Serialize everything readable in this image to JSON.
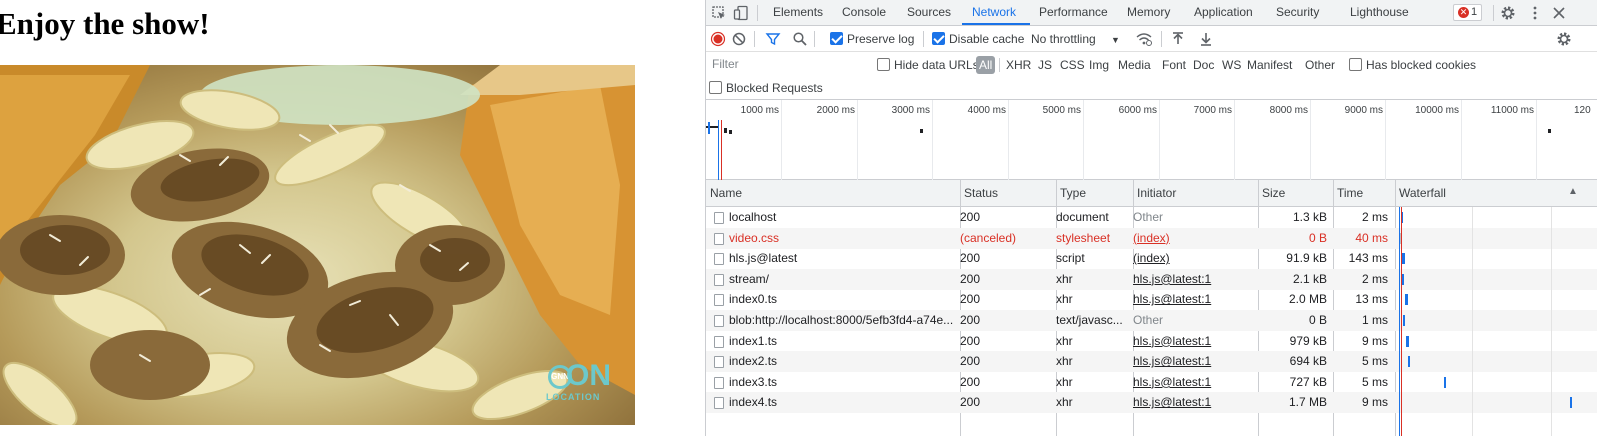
{
  "page": {
    "heading": "Enjoy the show!",
    "video_logo_big": "ON",
    "video_logo_small": "LOCATION",
    "video_logo_ring": "GNN"
  },
  "devtools": {
    "tabs": [
      "Elements",
      "Console",
      "Sources",
      "Network",
      "Performance",
      "Memory",
      "Application",
      "Security",
      "Lighthouse"
    ],
    "active_tab": "Network",
    "error_count": "1",
    "toolbar": {
      "preserve_log": "Preserve log",
      "preserve_log_checked": true,
      "disable_cache": "Disable cache",
      "disable_cache_checked": true,
      "throttling": "No throttling"
    },
    "filter": {
      "placeholder": "Filter",
      "hide_data_urls": "Hide data URLs",
      "types": [
        "All",
        "XHR",
        "JS",
        "CSS",
        "Img",
        "Media",
        "Font",
        "Doc",
        "WS",
        "Manifest",
        "Other"
      ],
      "has_blocked_cookies": "Has blocked cookies",
      "blocked_requests": "Blocked Requests"
    },
    "overview_labels": [
      "1000 ms",
      "2000 ms",
      "3000 ms",
      "4000 ms",
      "5000 ms",
      "6000 ms",
      "7000 ms",
      "8000 ms",
      "9000 ms",
      "10000 ms",
      "11000 ms",
      "120"
    ],
    "columns": {
      "name": "Name",
      "status": "Status",
      "type": "Type",
      "initiator": "Initiator",
      "size": "Size",
      "time": "Time",
      "waterfall": "Waterfall"
    },
    "requests": [
      {
        "name": "localhost",
        "status": "200",
        "type": "document",
        "initiator": "Other",
        "initiator_link": false,
        "size": "1.3 kB",
        "time": "2 ms",
        "error": false
      },
      {
        "name": "video.css",
        "status": "(canceled)",
        "type": "stylesheet",
        "initiator": "(index)",
        "initiator_link": true,
        "size": "0 B",
        "time": "40 ms",
        "error": true
      },
      {
        "name": "hls.js@latest",
        "status": "200",
        "type": "script",
        "initiator": "(index)",
        "initiator_link": true,
        "size": "91.9 kB",
        "time": "143 ms",
        "error": false
      },
      {
        "name": "stream/",
        "status": "200",
        "type": "xhr",
        "initiator": "hls.js@latest:1",
        "initiator_link": true,
        "size": "2.1 kB",
        "time": "2 ms",
        "error": false
      },
      {
        "name": "index0.ts",
        "status": "200",
        "type": "xhr",
        "initiator": "hls.js@latest:1",
        "initiator_link": true,
        "size": "2.0 MB",
        "time": "13 ms",
        "error": false
      },
      {
        "name": "blob:http://localhost:8000/5efb3fd4-a74e...",
        "status": "200",
        "type": "text/javasc...",
        "initiator": "Other",
        "initiator_link": false,
        "size": "0 B",
        "time": "1 ms",
        "error": false
      },
      {
        "name": "index1.ts",
        "status": "200",
        "type": "xhr",
        "initiator": "hls.js@latest:1",
        "initiator_link": true,
        "size": "979 kB",
        "time": "9 ms",
        "error": false
      },
      {
        "name": "index2.ts",
        "status": "200",
        "type": "xhr",
        "initiator": "hls.js@latest:1",
        "initiator_link": true,
        "size": "694 kB",
        "time": "5 ms",
        "error": false
      },
      {
        "name": "index3.ts",
        "status": "200",
        "type": "xhr",
        "initiator": "hls.js@latest:1",
        "initiator_link": true,
        "size": "727 kB",
        "time": "5 ms",
        "error": false
      },
      {
        "name": "index4.ts",
        "status": "200",
        "type": "xhr",
        "initiator": "hls.js@latest:1",
        "initiator_link": true,
        "size": "1.7 MB",
        "time": "9 ms",
        "error": false
      }
    ],
    "colors": {
      "accent": "#1a73e8",
      "record": "#d93025",
      "error_text": "#d93025"
    },
    "icons": [
      "inspect-icon",
      "device-toggle-icon",
      "record-icon",
      "clear-icon",
      "filter-icon",
      "search-icon",
      "network-conditions-icon",
      "import-har-icon",
      "export-har-icon",
      "settings-icon",
      "more-icon",
      "close-icon"
    ]
  }
}
